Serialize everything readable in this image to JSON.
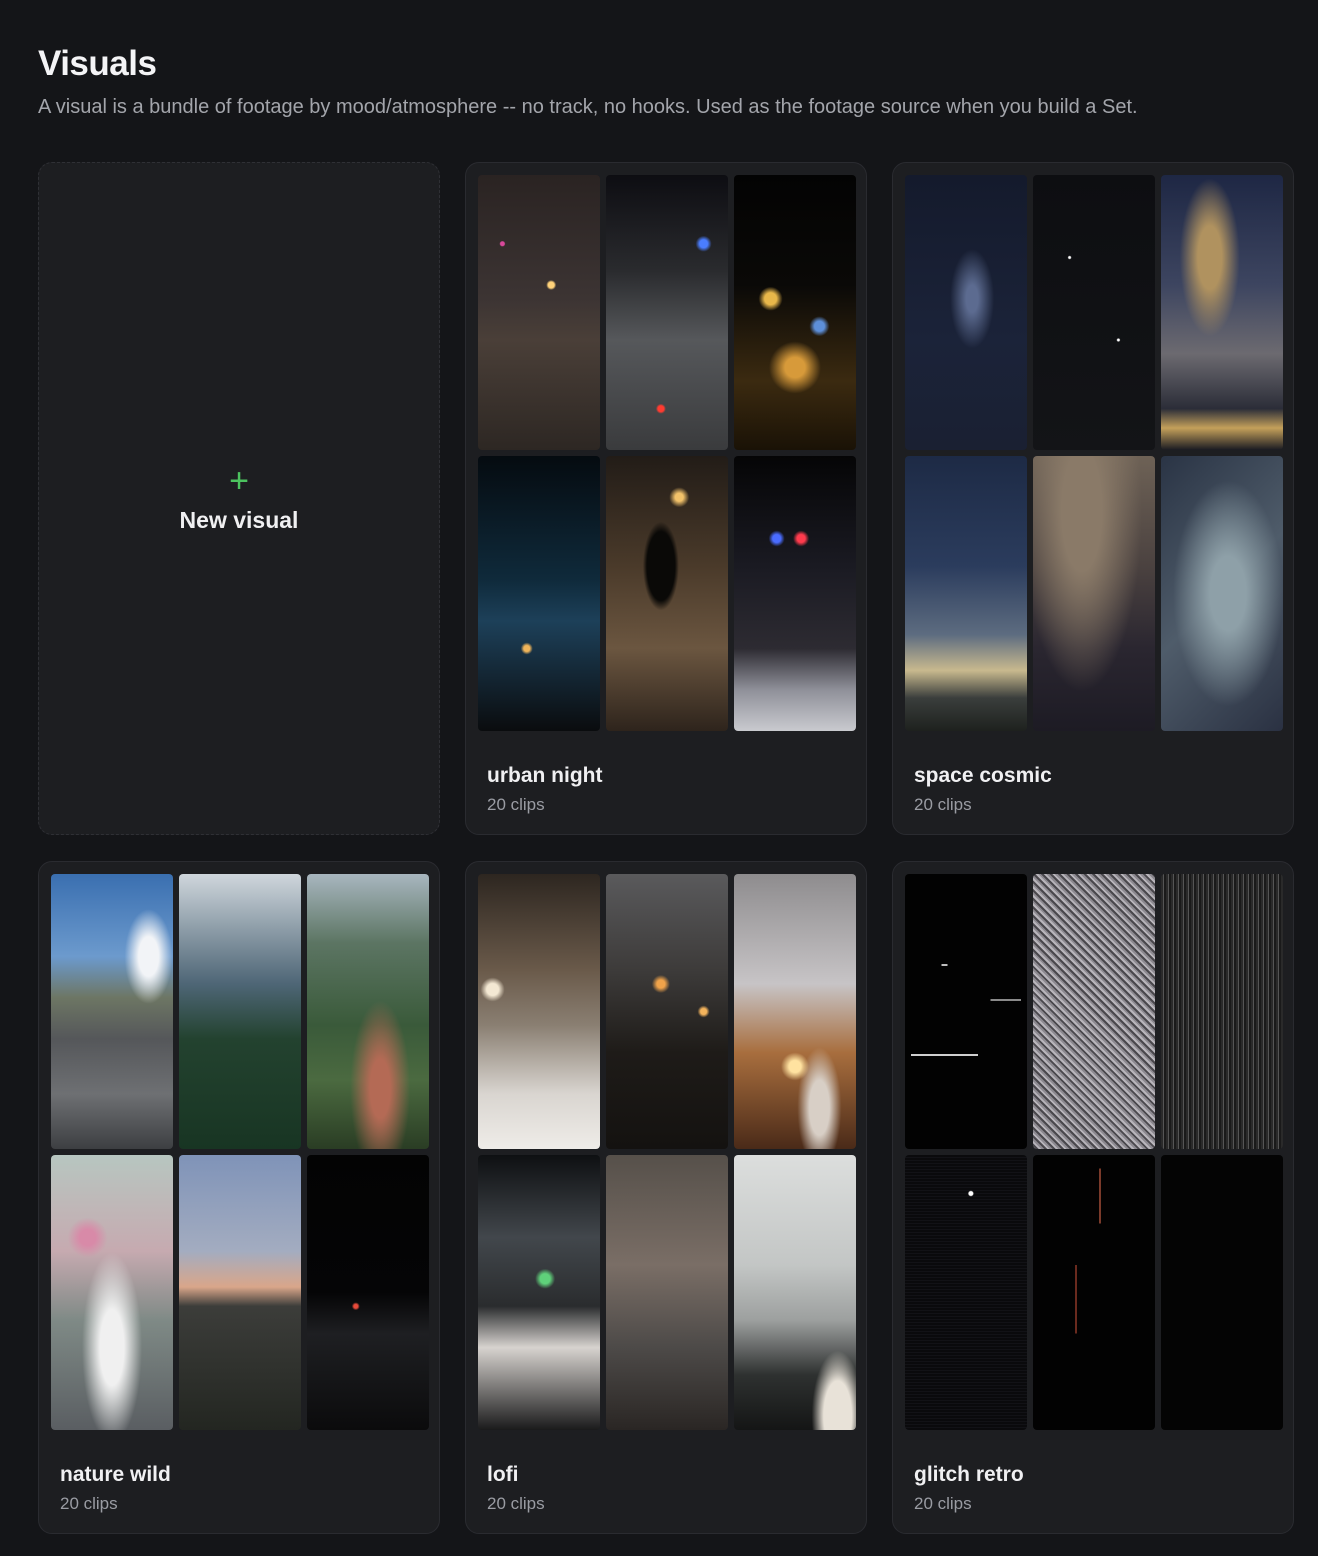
{
  "header": {
    "title": "Visuals",
    "subtitle": "A visual is a bundle of footage by mood/atmosphere -- no track, no hooks. Used as the footage source when you build a Set."
  },
  "new_visual": {
    "icon": "plus-icon",
    "plus_glyph": "+",
    "label": "New visual",
    "accent_color": "#4cc35f"
  },
  "visuals": [
    {
      "title": "urban night",
      "clips": "20 clips"
    },
    {
      "title": "space cosmic",
      "clips": "20 clips"
    },
    {
      "title": "nature wild",
      "clips": "20 clips"
    },
    {
      "title": "lofi",
      "clips": "20 clips"
    },
    {
      "title": "glitch retro",
      "clips": "20 clips"
    }
  ]
}
